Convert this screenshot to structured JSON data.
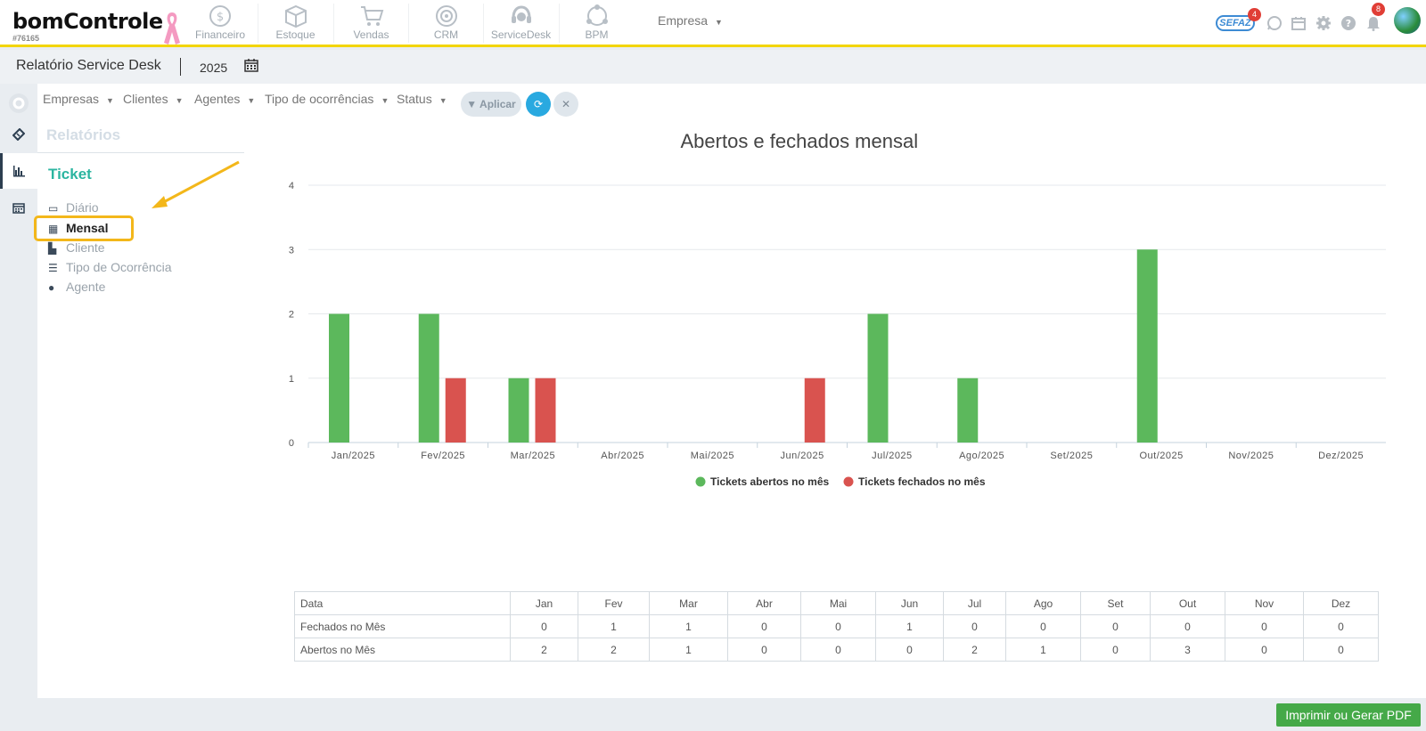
{
  "topnav": {
    "logo": "bomControle",
    "account_id": "#76165",
    "modules": [
      {
        "label": "Financeiro",
        "icon": "dollar-circle-icon"
      },
      {
        "label": "Estoque",
        "icon": "box-icon"
      },
      {
        "label": "Vendas",
        "icon": "cart-icon"
      },
      {
        "label": "CRM",
        "icon": "target-icon"
      },
      {
        "label": "ServiceDesk",
        "icon": "headset-icon"
      },
      {
        "label": "BPM",
        "icon": "flow-circle-icon"
      }
    ],
    "empresa_label": "Empresa",
    "sefaz_label": "SEFAZ",
    "sefaz_badge": "4",
    "notifications_badge": "8"
  },
  "subheader": {
    "title": "Relatório Service Desk",
    "year": "2025"
  },
  "filters": {
    "items": [
      "Empresas",
      "Clientes",
      "Agentes",
      "Tipo de ocorrências",
      "Status"
    ],
    "apply_label": "Aplicar"
  },
  "sidebar": {
    "section_title": "Relatórios",
    "group_title": "Ticket",
    "items": [
      {
        "label": "Diário",
        "icon": "calendar-minus-icon"
      },
      {
        "label": "Mensal",
        "icon": "calendar-grid-icon",
        "selected": true
      },
      {
        "label": "Cliente",
        "icon": "factory-icon"
      },
      {
        "label": "Tipo de Ocorrência",
        "icon": "list-icon"
      },
      {
        "label": "Agente",
        "icon": "user-icon"
      }
    ]
  },
  "chart_data": {
    "type": "bar",
    "title": "Abertos e fechados mensal",
    "categories": [
      "Jan/2025",
      "Fev/2025",
      "Mar/2025",
      "Abr/2025",
      "Mai/2025",
      "Jun/2025",
      "Jul/2025",
      "Ago/2025",
      "Set/2025",
      "Out/2025",
      "Nov/2025",
      "Dez/2025"
    ],
    "series": [
      {
        "name": "Tickets abertos no mês",
        "color": "#5cb85c",
        "values": [
          2,
          2,
          1,
          0,
          0,
          0,
          2,
          1,
          0,
          3,
          0,
          0
        ]
      },
      {
        "name": "Tickets fechados no mês",
        "color": "#d9534f",
        "values": [
          0,
          1,
          1,
          0,
          0,
          1,
          0,
          0,
          0,
          0,
          0,
          0
        ]
      }
    ],
    "ylim": [
      0,
      4
    ],
    "yticks": [
      0,
      1,
      2,
      3,
      4
    ],
    "grid": true,
    "legend": "bottom"
  },
  "table": {
    "header": [
      "Data",
      "Jan",
      "Fev",
      "Mar",
      "Abr",
      "Mai",
      "Jun",
      "Jul",
      "Ago",
      "Set",
      "Out",
      "Nov",
      "Dez"
    ],
    "rows": [
      {
        "label": "Fechados no Mês",
        "values": [
          "0",
          "1",
          "1",
          "0",
          "0",
          "1",
          "0",
          "0",
          "0",
          "0",
          "0",
          "0"
        ]
      },
      {
        "label": "Abertos no Mês",
        "values": [
          "2",
          "2",
          "1",
          "0",
          "0",
          "0",
          "2",
          "1",
          "0",
          "3",
          "0",
          "0"
        ]
      }
    ]
  },
  "footer": {
    "print_label": "Imprimir ou Gerar PDF"
  }
}
